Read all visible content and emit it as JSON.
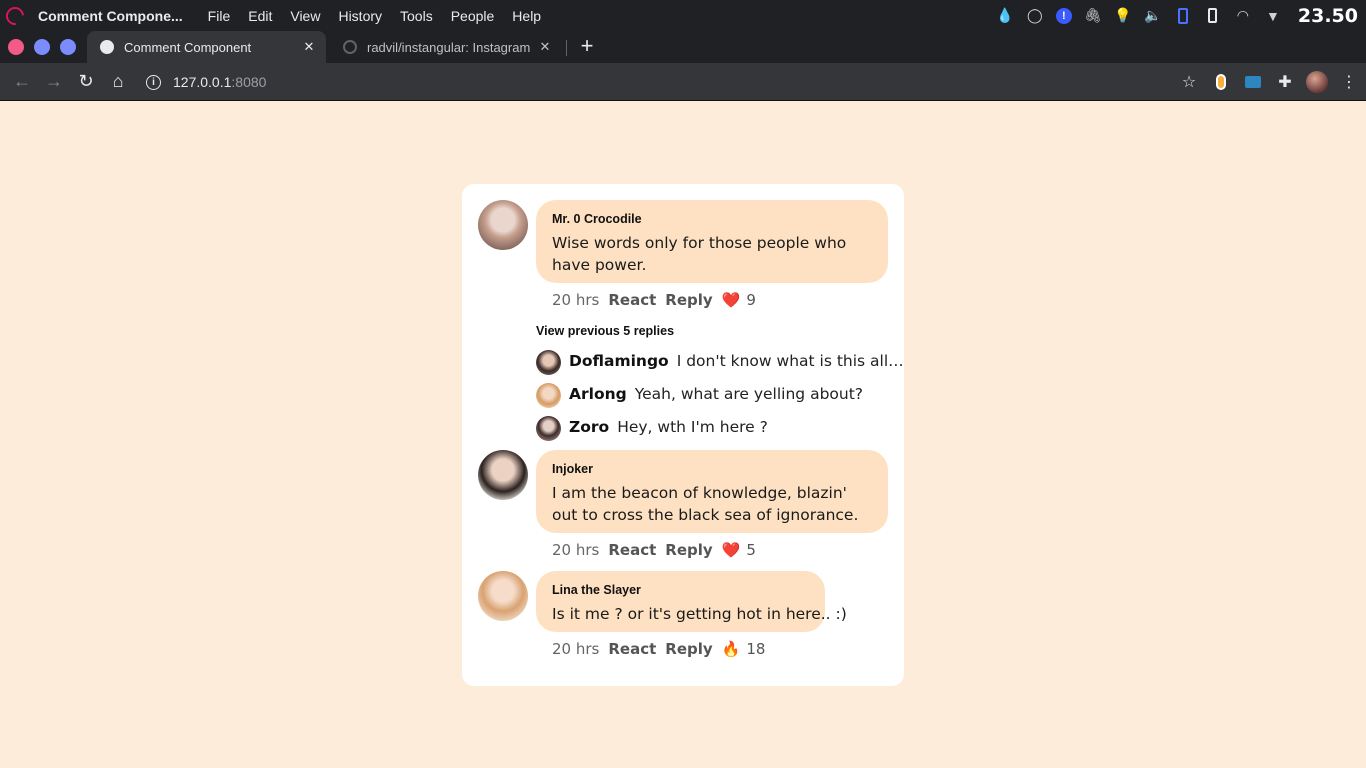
{
  "os": {
    "app_title": "Comment Compone...",
    "menu": [
      "File",
      "Edit",
      "View",
      "History",
      "Tools",
      "People",
      "Help"
    ],
    "clock": "23.50"
  },
  "tabs": [
    {
      "title": "Comment Component",
      "close": "✕"
    },
    {
      "title": "radvil/instangular: Instagram",
      "close": "✕"
    }
  ],
  "new_tab": "+",
  "toolbar": {
    "url_host": "127.0.0.1",
    "url_port": ":8080"
  },
  "comments": [
    {
      "author": "Mr. 0 Crocodile",
      "text": "Wise words only for those people who have power.",
      "time": "20 hrs",
      "react": "React",
      "reply": "Reply",
      "emoji": "❤️",
      "count": "9"
    },
    {
      "author": "Injoker",
      "text": "I am the beacon of knowledge, blazin' out to cross the black sea of ignorance.",
      "time": "20 hrs",
      "react": "React",
      "reply": "Reply",
      "emoji": "❤️",
      "count": "5"
    },
    {
      "author": "Lina the Slayer",
      "text": "Is it me ? or it's getting hot in here.. :)",
      "time": "20 hrs",
      "react": "React",
      "reply": "Reply",
      "emoji": "🔥",
      "count": "18"
    }
  ],
  "view_previous": "View previous 5 replies",
  "replies": [
    {
      "name": "Doflamingo",
      "text": "I don't know what is this all…"
    },
    {
      "name": "Arlong",
      "text": "Yeah, what are yelling about?"
    },
    {
      "name": "Zoro",
      "text": "Hey, wth I'm here ?"
    }
  ]
}
